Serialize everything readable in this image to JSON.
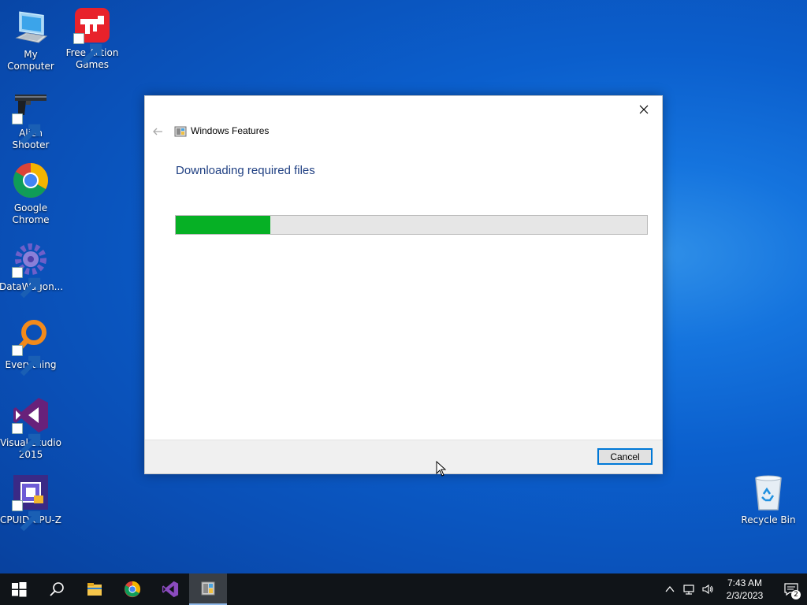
{
  "desktop": {
    "icons": [
      {
        "label": "My Computer",
        "icon": "computer-icon"
      },
      {
        "label": "Free Action Games",
        "icon": "gun-game-icon"
      },
      {
        "label": "Alien Shooter",
        "icon": "pistol-icon"
      },
      {
        "label": "Google Chrome",
        "icon": "chrome-icon"
      },
      {
        "label": "DataWagon...",
        "icon": "gear-icon"
      },
      {
        "label": "Everything",
        "icon": "magnifier-icon"
      },
      {
        "label": "Visual Studio 2015",
        "icon": "visual-studio-icon"
      },
      {
        "label": "CPUID CPU-Z",
        "icon": "cpu-icon"
      },
      {
        "label": "Recycle Bin",
        "icon": "recycle-bin-icon"
      }
    ]
  },
  "dialog": {
    "title": "Windows Features",
    "heading": "Downloading required files",
    "progress_fraction": 0.2,
    "cancel_label": "Cancel"
  },
  "taskbar": {
    "apps": [
      "start-icon",
      "search-icon",
      "file-explorer-icon",
      "chrome-icon",
      "visual-studio-icon",
      "windows-features-icon"
    ],
    "time": "7:43 AM",
    "date": "2/3/2023",
    "notification_count": "2"
  },
  "colors": {
    "progress": "#06b025",
    "heading": "#1f3f82",
    "accent": "#0078d7"
  }
}
